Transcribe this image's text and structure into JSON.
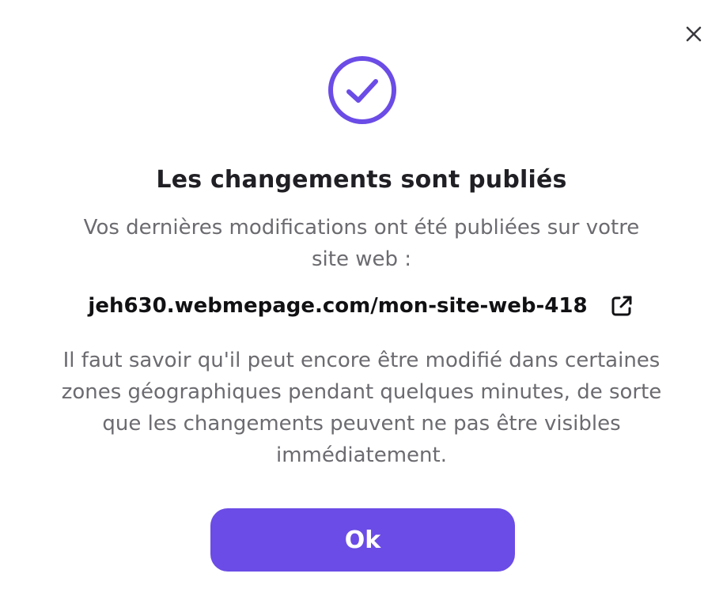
{
  "dialog": {
    "title": "Les changements sont publiés",
    "subtitle": "Vos dernières modifications ont été publiées sur votre site web :",
    "site_url": "jeh630.webmepage.com/mon-site-web-418",
    "info": "Il faut savoir qu'il peut encore être modifié dans certaines zones géographiques pendant quelques minutes, de sorte que les changements peuvent ne pas être visibles immédiatement.",
    "ok_label": "Ok"
  },
  "icons": {
    "close": "close-icon",
    "success": "check-circle-icon",
    "external_link": "external-link-icon"
  },
  "colors": {
    "accent": "#6b4ce6",
    "title": "#1f1f24",
    "body_text": "#6b6b70"
  }
}
